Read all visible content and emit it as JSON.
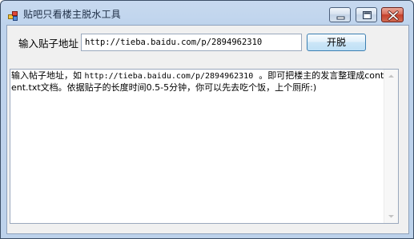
{
  "window": {
    "title": "贴吧只看楼主脱水工具",
    "controls": [
      "minimize-icon",
      "maximize-icon",
      "close-icon"
    ]
  },
  "form": {
    "url_label": "输入贴子地址",
    "url_value": "http://tieba.baidu.com/p/2894962310",
    "submit_label": "开脱"
  },
  "output": {
    "text_part1": "输入帖子地址，如 ",
    "example_url": "http://tieba.baidu.com/p/2894962310",
    "text_part2": "  。即可把楼主的发言整理成content.txt文档。依据贴子的长度时间0.5-5分钟，你可以先去吃个饭，上个厕所:)"
  },
  "colors": {
    "titlebar": "#c2d6ee",
    "close_button": "#c4402c",
    "client_bg": "#f0f0f0"
  }
}
